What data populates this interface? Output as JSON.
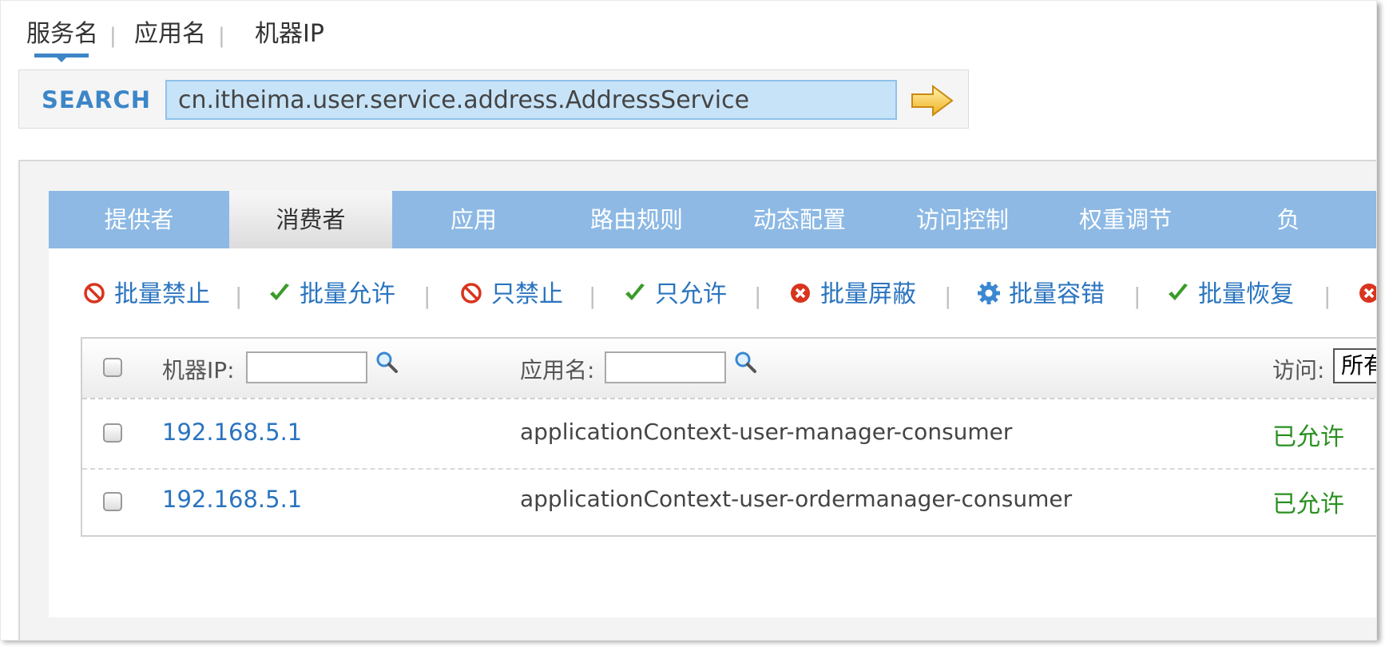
{
  "search_tabs": [
    "服务名",
    "应用名",
    "机器IP"
  ],
  "search": {
    "label": "SEARCH",
    "value": "cn.itheima.user.service.address.AddressService"
  },
  "tabs": [
    "提供者",
    "消费者",
    "应用",
    "路由规则",
    "动态配置",
    "访问控制",
    "权重调节",
    "负"
  ],
  "active_tab": "消费者",
  "toolbar": [
    {
      "label": "批量禁止",
      "icon": "ban-icon"
    },
    {
      "label": "批量允许",
      "icon": "check-icon"
    },
    {
      "label": "只禁止",
      "icon": "ban-icon"
    },
    {
      "label": "只允许",
      "icon": "check-icon"
    },
    {
      "label": "批量屏蔽",
      "icon": "red-x-circle-icon"
    },
    {
      "label": "批量容错",
      "icon": "gear-icon"
    },
    {
      "label": "批量恢复",
      "icon": "check-icon"
    }
  ],
  "table": {
    "header": {
      "ip_label": "机器IP:",
      "app_label": "应用名:",
      "access_label": "访问:",
      "access_select": "所有"
    },
    "rows": [
      {
        "ip": "192.168.5.1",
        "app": "applicationContext-user-manager-consumer",
        "status": "已允许"
      },
      {
        "ip": "192.168.5.1",
        "app": "applicationContext-user-ordermanager-consumer",
        "status": "已允许"
      }
    ]
  },
  "colors": {
    "tab_bar": "#8db9e4",
    "link": "#2a74bf",
    "allowed": "#2a9020",
    "search_label": "#3c86c8"
  }
}
